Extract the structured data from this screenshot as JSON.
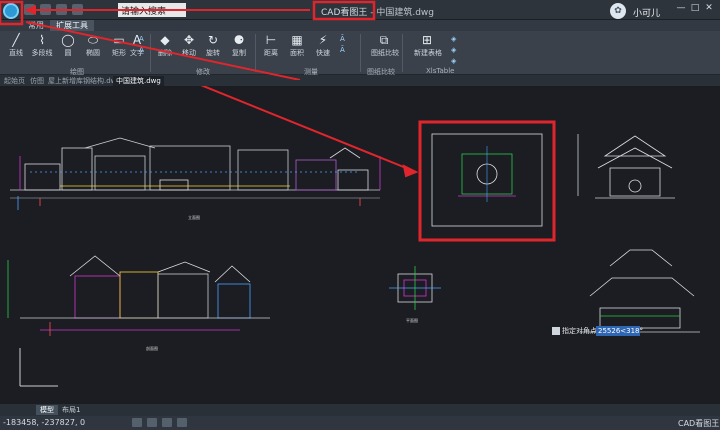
{
  "window": {
    "title_app": "CAD看图王",
    "title_file": "中国建筑.dwg",
    "search_value": "请输入搜索",
    "user_name": "小可儿",
    "user_avatar": "✿",
    "controls": [
      "—",
      "□",
      "✕"
    ]
  },
  "menu": {
    "items": [
      "常用",
      "扩展工具"
    ]
  },
  "ribbon": {
    "tools": [
      {
        "label": "直线",
        "icon": "line-icon",
        "glyph": "╱"
      },
      {
        "label": "多段线",
        "icon": "polyline-icon",
        "glyph": "⌇"
      },
      {
        "label": "圆",
        "icon": "circle-icon",
        "glyph": "◯"
      },
      {
        "label": "椭圆",
        "icon": "ellipse-icon",
        "glyph": "⬭"
      },
      {
        "label": "矩形",
        "icon": "rectangle-icon",
        "glyph": "▭"
      },
      {
        "label": "文字",
        "icon": "text-icon",
        "glyph": "A"
      },
      {
        "label": "删除",
        "icon": "eraser-icon",
        "glyph": "◆"
      },
      {
        "label": "移动",
        "icon": "move-icon",
        "glyph": "✥"
      },
      {
        "label": "旋转",
        "icon": "rotate-icon",
        "glyph": "↻"
      },
      {
        "label": "复制",
        "icon": "copy-icon",
        "glyph": "⚈"
      },
      {
        "label": "距离",
        "icon": "distance-icon",
        "glyph": "⊢"
      },
      {
        "label": "面积",
        "icon": "area-icon",
        "glyph": "▦"
      },
      {
        "label": "快速",
        "icon": "quick-measure-icon",
        "glyph": "⚡"
      },
      {
        "label": "图纸比较",
        "icon": "compare-icon",
        "glyph": "⧉"
      },
      {
        "label": "新建表格",
        "icon": "table-icon",
        "glyph": "⊞"
      }
    ],
    "groups": [
      "绘图",
      "修改",
      "测量",
      "图纸比较",
      "XlsTable"
    ]
  },
  "doc_tabs": [
    "起始页",
    "仿图",
    "屋上新增库钢结构.dwg",
    "中国建筑.dwg"
  ],
  "drawing": {
    "bg": "#1b1d22",
    "highlight_color": "#e0262c",
    "labels": [
      "立面图",
      "剖面图",
      "平面图"
    ],
    "prompt_label": "指定对角点:",
    "prompt_value": "25526<318°"
  },
  "layout_tabs": [
    "模型",
    "布局1"
  ],
  "status": {
    "coords": "-183458, -237827, 0",
    "app_name": "CAD看图王"
  }
}
